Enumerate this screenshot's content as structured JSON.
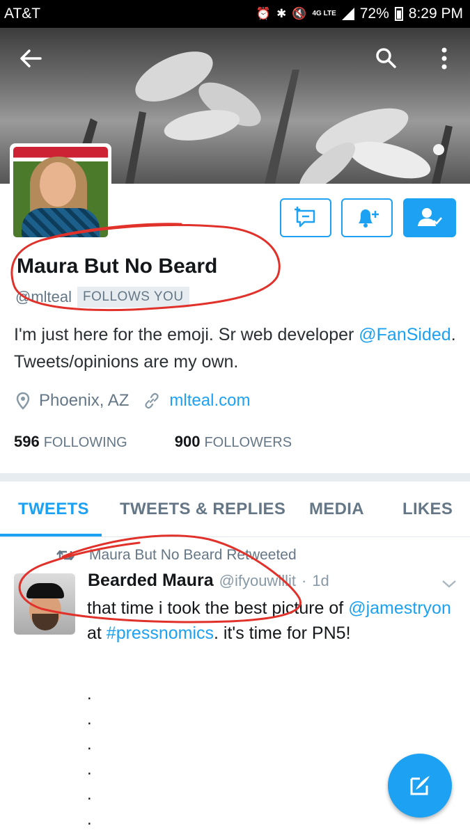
{
  "status_bar": {
    "carrier": "AT&T",
    "network": "4G LTE",
    "battery": "72%",
    "time": "8:29 PM",
    "icons": [
      "alarm-icon",
      "bluetooth-icon",
      "mute-icon",
      "4g-lte-icon",
      "signal-icon",
      "battery-icon"
    ]
  },
  "header": {
    "back_icon": "arrow-left-icon",
    "search_icon": "search-icon",
    "more_icon": "more-vertical-icon"
  },
  "profile": {
    "name": "Maura But No Beard",
    "handle": "@mlteal",
    "follows_you": "FOLLOWS YOU",
    "bio_text": "I'm just here for the emoji. Sr web developer ",
    "bio_mention": "@FanSided",
    "bio_text_2": ". Tweets/opinions are my own.",
    "location": "Phoenix, AZ",
    "website": "mlteal.com",
    "following_count": "596",
    "following_label": "FOLLOWING",
    "followers_count": "900",
    "followers_label": "FOLLOWERS"
  },
  "actions": {
    "dm_icon": "direct-message-icon",
    "notify_icon": "bell-plus-icon",
    "following_icon": "user-check-icon"
  },
  "tabs": [
    {
      "label": "TWEETS",
      "active": true
    },
    {
      "label": "TWEETS & REPLIES",
      "active": false
    },
    {
      "label": "MEDIA",
      "active": false
    },
    {
      "label": "LIKES",
      "active": false
    }
  ],
  "tweet": {
    "retweet_label": "Maura But No Beard Retweeted",
    "author": "Bearded Maura",
    "author_handle": "@ifyouwillit",
    "time": "1d",
    "text_1": "that time i took the best picture of ",
    "mention": "@jamestryon",
    "text_2": " at ",
    "hashtag": "#pressnomics",
    "text_3": ". it's time for PN5!",
    "dots": [
      ".",
      ".",
      ".",
      ".",
      ".",
      "."
    ]
  },
  "colors": {
    "accent": "#1da1f2",
    "annotation": "#e0312a",
    "muted": "#657786"
  }
}
